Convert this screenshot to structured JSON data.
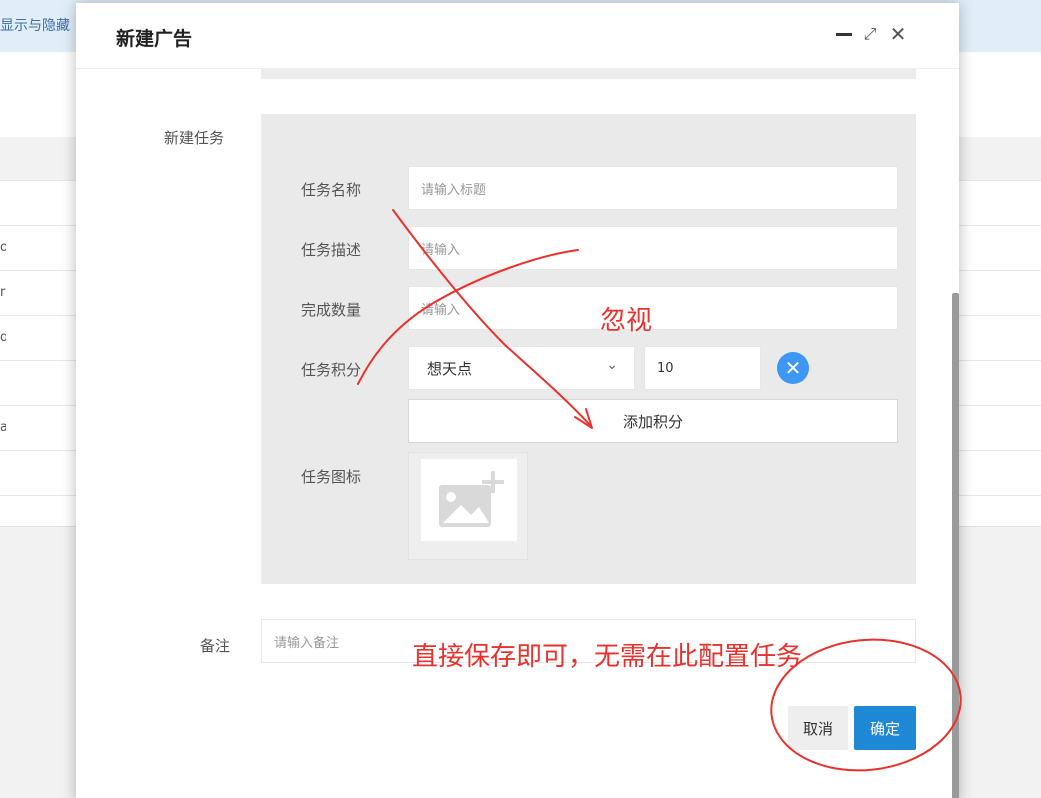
{
  "background": {
    "banner_text": "显示与隐藏",
    "row_fragments": [
      "o",
      "r",
      "d",
      "a"
    ]
  },
  "modal": {
    "title": "新建广告",
    "icons": {
      "minimize": "minimize-icon",
      "maximize": "maximize-icon",
      "close": "close-icon"
    },
    "maximize_glyph": "⤢",
    "close_glyph": "✕",
    "task_section_label": "新建任务",
    "task": {
      "name_label": "任务名称",
      "name_placeholder": "请输入标题",
      "desc_label": "任务描述",
      "desc_placeholder": "请输入",
      "count_label": "完成数量",
      "count_placeholder": "请输入",
      "points_label": "任务积分",
      "points_type_selected": "想天点",
      "points_value": "10",
      "remove_glyph": "✕",
      "add_points_label": "添加积分",
      "icon_label": "任务图标"
    },
    "remark_label": "备注",
    "remark_placeholder": "请输入备注",
    "cancel_label": "取消",
    "confirm_label": "确定"
  },
  "annotations": {
    "ignore_note": "忽视",
    "save_note": "直接保存即可，无需在此配置任务",
    "color": "#e8322e"
  },
  "colors": {
    "primary": "#1e88d6",
    "remove_button": "#3d97f5",
    "panel_bg": "#eaeaea",
    "banner_bg": "#e1eef9"
  }
}
